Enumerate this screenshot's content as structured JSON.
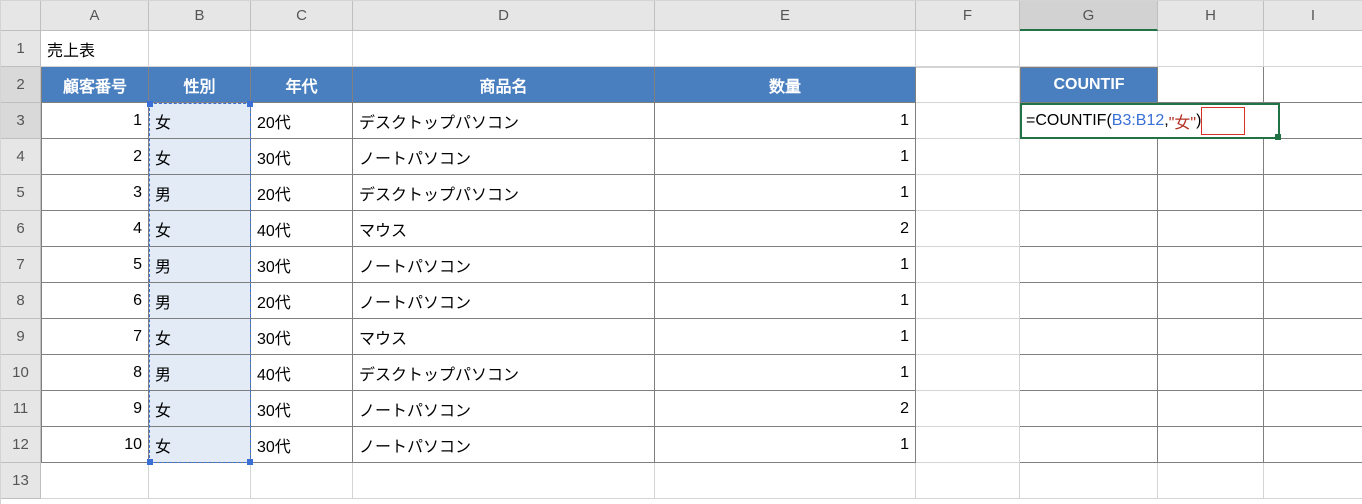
{
  "columns": [
    "A",
    "B",
    "C",
    "D",
    "E",
    "F",
    "G",
    "H",
    "I"
  ],
  "col_widths": {
    "A": 108,
    "B": 102,
    "C": 102,
    "D": 302,
    "E": 261,
    "F": 104,
    "G": 138,
    "H": 106,
    "I": 99
  },
  "rows": [
    1,
    2,
    3,
    4,
    5,
    6,
    7,
    8,
    9,
    10,
    11,
    12,
    13
  ],
  "title_cell": "売上表",
  "headers": {
    "A": "顧客番号",
    "B": "性別",
    "C": "年代",
    "D": "商品名",
    "E": "数量"
  },
  "g2_label": "COUNTIF",
  "formula": {
    "prefix": "=COUNTIF(",
    "range": "B3:B12",
    "comma": ",",
    "criteria": "\"女\"",
    "suffix": ")"
  },
  "data_rows": [
    {
      "id": "1",
      "sex": "女",
      "age": "20代",
      "item": "デスクトップパソコン",
      "qty": "1"
    },
    {
      "id": "2",
      "sex": "女",
      "age": "30代",
      "item": "ノートパソコン",
      "qty": "1"
    },
    {
      "id": "3",
      "sex": "男",
      "age": "20代",
      "item": "デスクトップパソコン",
      "qty": "1"
    },
    {
      "id": "4",
      "sex": "女",
      "age": "40代",
      "item": "マウス",
      "qty": "2"
    },
    {
      "id": "5",
      "sex": "男",
      "age": "30代",
      "item": "ノートパソコン",
      "qty": "1"
    },
    {
      "id": "6",
      "sex": "男",
      "age": "20代",
      "item": "ノートパソコン",
      "qty": "1"
    },
    {
      "id": "7",
      "sex": "女",
      "age": "30代",
      "item": "マウス",
      "qty": "1"
    },
    {
      "id": "8",
      "sex": "男",
      "age": "40代",
      "item": "デスクトップパソコン",
      "qty": "1"
    },
    {
      "id": "9",
      "sex": "女",
      "age": "30代",
      "item": "ノートパソコン",
      "qty": "2"
    },
    {
      "id": "10",
      "sex": "女",
      "age": "30代",
      "item": "ノートパソコン",
      "qty": "1"
    }
  ],
  "chart_data": {
    "type": "table",
    "title": "売上表",
    "columns": [
      "顧客番号",
      "性別",
      "年代",
      "商品名",
      "数量"
    ],
    "rows": [
      [
        1,
        "女",
        "20代",
        "デスクトップパソコン",
        1
      ],
      [
        2,
        "女",
        "30代",
        "ノートパソコン",
        1
      ],
      [
        3,
        "男",
        "20代",
        "デスクトップパソコン",
        1
      ],
      [
        4,
        "女",
        "40代",
        "マウス",
        2
      ],
      [
        5,
        "男",
        "30代",
        "ノートパソコン",
        1
      ],
      [
        6,
        "男",
        "20代",
        "ノートパソコン",
        1
      ],
      [
        7,
        "女",
        "30代",
        "マウス",
        1
      ],
      [
        8,
        "男",
        "40代",
        "デスクトップパソコン",
        1
      ],
      [
        9,
        "女",
        "30代",
        "ノートパソコン",
        2
      ],
      [
        10,
        "女",
        "30代",
        "ノートパソコン",
        1
      ]
    ],
    "formula_cell": {
      "address": "G3",
      "formula": "=COUNTIF(B3:B12,\"女\")"
    }
  }
}
